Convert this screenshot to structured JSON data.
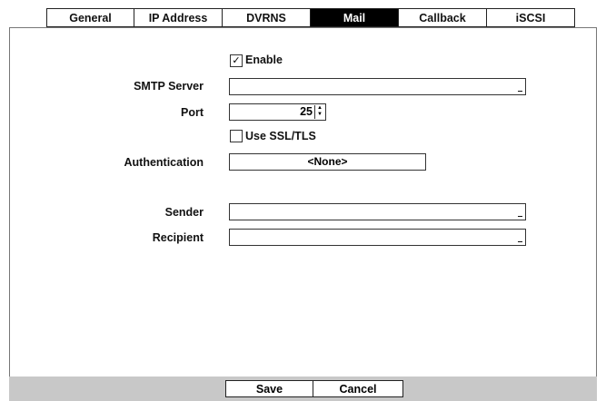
{
  "tabs": [
    {
      "label": "General",
      "active": false
    },
    {
      "label": "IP Address",
      "active": false
    },
    {
      "label": "DVRNS",
      "active": false
    },
    {
      "label": "Mail",
      "active": true
    },
    {
      "label": "Callback",
      "active": false
    },
    {
      "label": "iSCSI",
      "active": false
    }
  ],
  "form": {
    "enable": {
      "label": "Enable",
      "checked": true,
      "mark": "✓"
    },
    "smtp_server": {
      "label": "SMTP Server",
      "value": ""
    },
    "port": {
      "label": "Port",
      "value": "25"
    },
    "ssl": {
      "label": "Use SSL/TLS",
      "checked": false
    },
    "authentication": {
      "label": "Authentication",
      "value": "<None>"
    },
    "sender": {
      "label": "Sender",
      "value": ""
    },
    "recipient": {
      "label": "Recipient",
      "value": ""
    }
  },
  "buttons": {
    "save": "Save",
    "cancel": "Cancel"
  },
  "colors": {
    "active_tab": "#000000",
    "bottom_bar": "#c8c8c8"
  }
}
